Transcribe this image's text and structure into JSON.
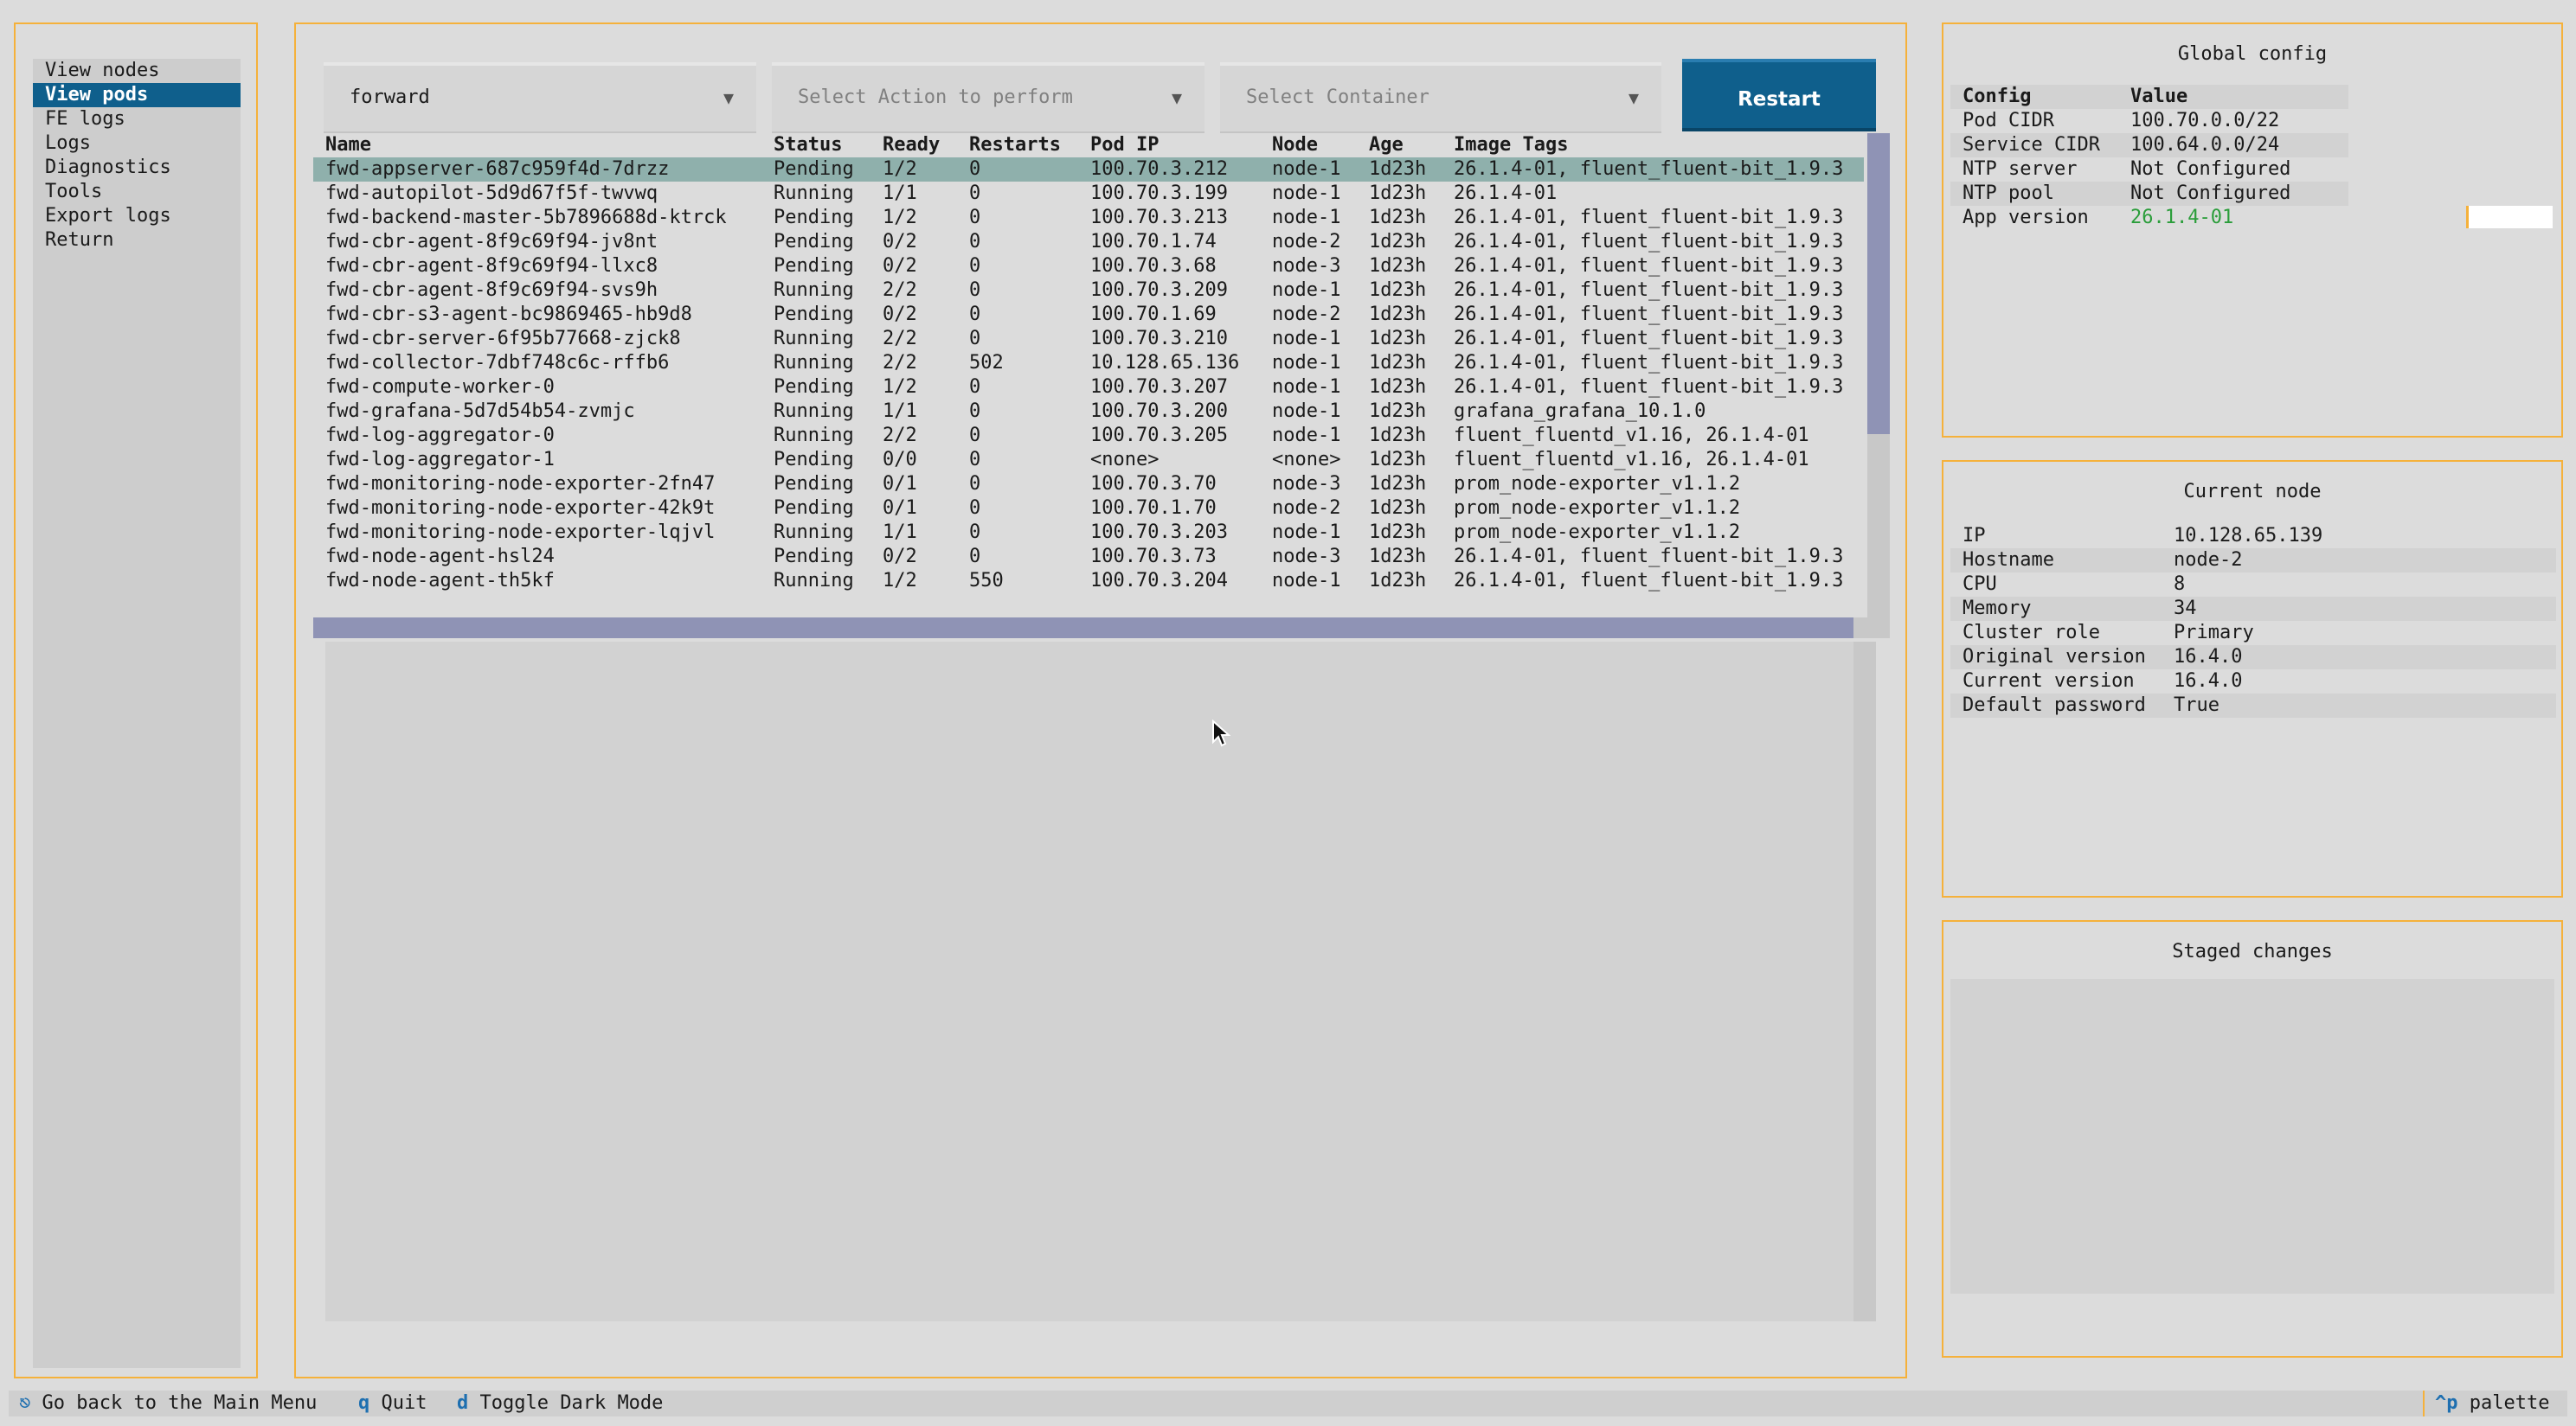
{
  "sidebar": {
    "items": [
      {
        "label": "View nodes"
      },
      {
        "label": "View pods",
        "selected": true
      },
      {
        "label": "FE logs"
      },
      {
        "label": "Logs"
      },
      {
        "label": "Diagnostics"
      },
      {
        "label": "Tools"
      },
      {
        "label": "Export logs"
      },
      {
        "label": "Return"
      }
    ]
  },
  "toolbar": {
    "namespace_value": "forward",
    "action_placeholder": "Select Action to perform",
    "container_placeholder": "Select Container",
    "restart_label": "Restart"
  },
  "pods_table": {
    "columns": [
      "Name",
      "Status",
      "Ready",
      "Restarts",
      "Pod IP",
      "Node",
      "Age",
      "Image Tags"
    ],
    "rows": [
      [
        "fwd-appserver-687c959f4d-7drzz",
        "Pending",
        "1/2",
        "0",
        "100.70.3.212",
        "node-1",
        "1d23h",
        "26.1.4-01, fluent_fluent-bit_1.9.3"
      ],
      [
        "fwd-autopilot-5d9d67f5f-twvwq",
        "Running",
        "1/1",
        "0",
        "100.70.3.199",
        "node-1",
        "1d23h",
        "26.1.4-01"
      ],
      [
        "fwd-backend-master-5b7896688d-ktrck",
        "Pending",
        "1/2",
        "0",
        "100.70.3.213",
        "node-1",
        "1d23h",
        "26.1.4-01, fluent_fluent-bit_1.9.3"
      ],
      [
        "fwd-cbr-agent-8f9c69f94-jv8nt",
        "Pending",
        "0/2",
        "0",
        "100.70.1.74",
        "node-2",
        "1d23h",
        "26.1.4-01, fluent_fluent-bit_1.9.3"
      ],
      [
        "fwd-cbr-agent-8f9c69f94-llxc8",
        "Pending",
        "0/2",
        "0",
        "100.70.3.68",
        "node-3",
        "1d23h",
        "26.1.4-01, fluent_fluent-bit_1.9.3"
      ],
      [
        "fwd-cbr-agent-8f9c69f94-svs9h",
        "Running",
        "2/2",
        "0",
        "100.70.3.209",
        "node-1",
        "1d23h",
        "26.1.4-01, fluent_fluent-bit_1.9.3"
      ],
      [
        "fwd-cbr-s3-agent-bc9869465-hb9d8",
        "Pending",
        "0/2",
        "0",
        "100.70.1.69",
        "node-2",
        "1d23h",
        "26.1.4-01, fluent_fluent-bit_1.9.3"
      ],
      [
        "fwd-cbr-server-6f95b77668-zjck8",
        "Running",
        "2/2",
        "0",
        "100.70.3.210",
        "node-1",
        "1d23h",
        "26.1.4-01, fluent_fluent-bit_1.9.3"
      ],
      [
        "fwd-collector-7dbf748c6c-rffb6",
        "Running",
        "2/2",
        "502",
        "10.128.65.136",
        "node-1",
        "1d23h",
        "26.1.4-01, fluent_fluent-bit_1.9.3"
      ],
      [
        "fwd-compute-worker-0",
        "Pending",
        "1/2",
        "0",
        "100.70.3.207",
        "node-1",
        "1d23h",
        "26.1.4-01, fluent_fluent-bit_1.9.3"
      ],
      [
        "fwd-grafana-5d7d54b54-zvmjc",
        "Running",
        "1/1",
        "0",
        "100.70.3.200",
        "node-1",
        "1d23h",
        "grafana_grafana_10.1.0"
      ],
      [
        "fwd-log-aggregator-0",
        "Running",
        "2/2",
        "0",
        "100.70.3.205",
        "node-1",
        "1d23h",
        "fluent_fluentd_v1.16, 26.1.4-01"
      ],
      [
        "fwd-log-aggregator-1",
        "Pending",
        "0/0",
        "0",
        "<none>",
        "<none>",
        "1d23h",
        "fluent_fluentd_v1.16, 26.1.4-01"
      ],
      [
        "fwd-monitoring-node-exporter-2fn47",
        "Pending",
        "0/1",
        "0",
        "100.70.3.70",
        "node-3",
        "1d23h",
        "prom_node-exporter_v1.1.2"
      ],
      [
        "fwd-monitoring-node-exporter-42k9t",
        "Pending",
        "0/1",
        "0",
        "100.70.1.70",
        "node-2",
        "1d23h",
        "prom_node-exporter_v1.1.2"
      ],
      [
        "fwd-monitoring-node-exporter-lqjvl",
        "Running",
        "1/1",
        "0",
        "100.70.3.203",
        "node-1",
        "1d23h",
        "prom_node-exporter_v1.1.2"
      ],
      [
        "fwd-node-agent-hsl24",
        "Pending",
        "0/2",
        "0",
        "100.70.3.73",
        "node-3",
        "1d23h",
        "26.1.4-01, fluent_fluent-bit_1.9.3"
      ],
      [
        "fwd-node-agent-th5kf",
        "Running",
        "1/2",
        "550",
        "100.70.3.204",
        "node-1",
        "1d23h",
        "26.1.4-01, fluent_fluent-bit_1.9.3"
      ]
    ]
  },
  "global_config": {
    "title": "Global config",
    "header": {
      "key": "Config",
      "value": "Value"
    },
    "rows": [
      {
        "key": "Pod CIDR",
        "value": "100.70.0.0/22"
      },
      {
        "key": "Service CIDR",
        "value": "100.64.0.0/24"
      },
      {
        "key": "NTP server",
        "value": "Not Configured"
      },
      {
        "key": "NTP pool",
        "value": "Not Configured"
      },
      {
        "key": "App version",
        "value": "26.1.4-01"
      }
    ],
    "app_version_color": "#2a9d3a"
  },
  "current_node": {
    "title": "Current node",
    "rows": [
      {
        "key": "IP",
        "value": "10.128.65.139"
      },
      {
        "key": "Hostname",
        "value": "node-2"
      },
      {
        "key": "CPU",
        "value": "8"
      },
      {
        "key": "Memory",
        "value": "34"
      },
      {
        "key": "Cluster role",
        "value": "Primary"
      },
      {
        "key": "Original version",
        "value": "16.4.0"
      },
      {
        "key": "Current version",
        "value": "16.4.0"
      },
      {
        "key": "Default password",
        "value": "True"
      }
    ]
  },
  "staged_changes": {
    "title": "Staged changes"
  },
  "footer": {
    "main_menu_key": "⎋",
    "main_menu_label": "Go back to the Main Menu",
    "quit_key": "q",
    "quit_label": "Quit",
    "dark_key": "d",
    "dark_label": "Toggle Dark Mode",
    "palette_key": "^p",
    "palette_label": "palette"
  },
  "colors": {
    "accent": "#0f5f8c",
    "panel_border": "#f5b13b",
    "selected_row": "#8fb0ac",
    "scrollbar": "#8f93b5"
  }
}
